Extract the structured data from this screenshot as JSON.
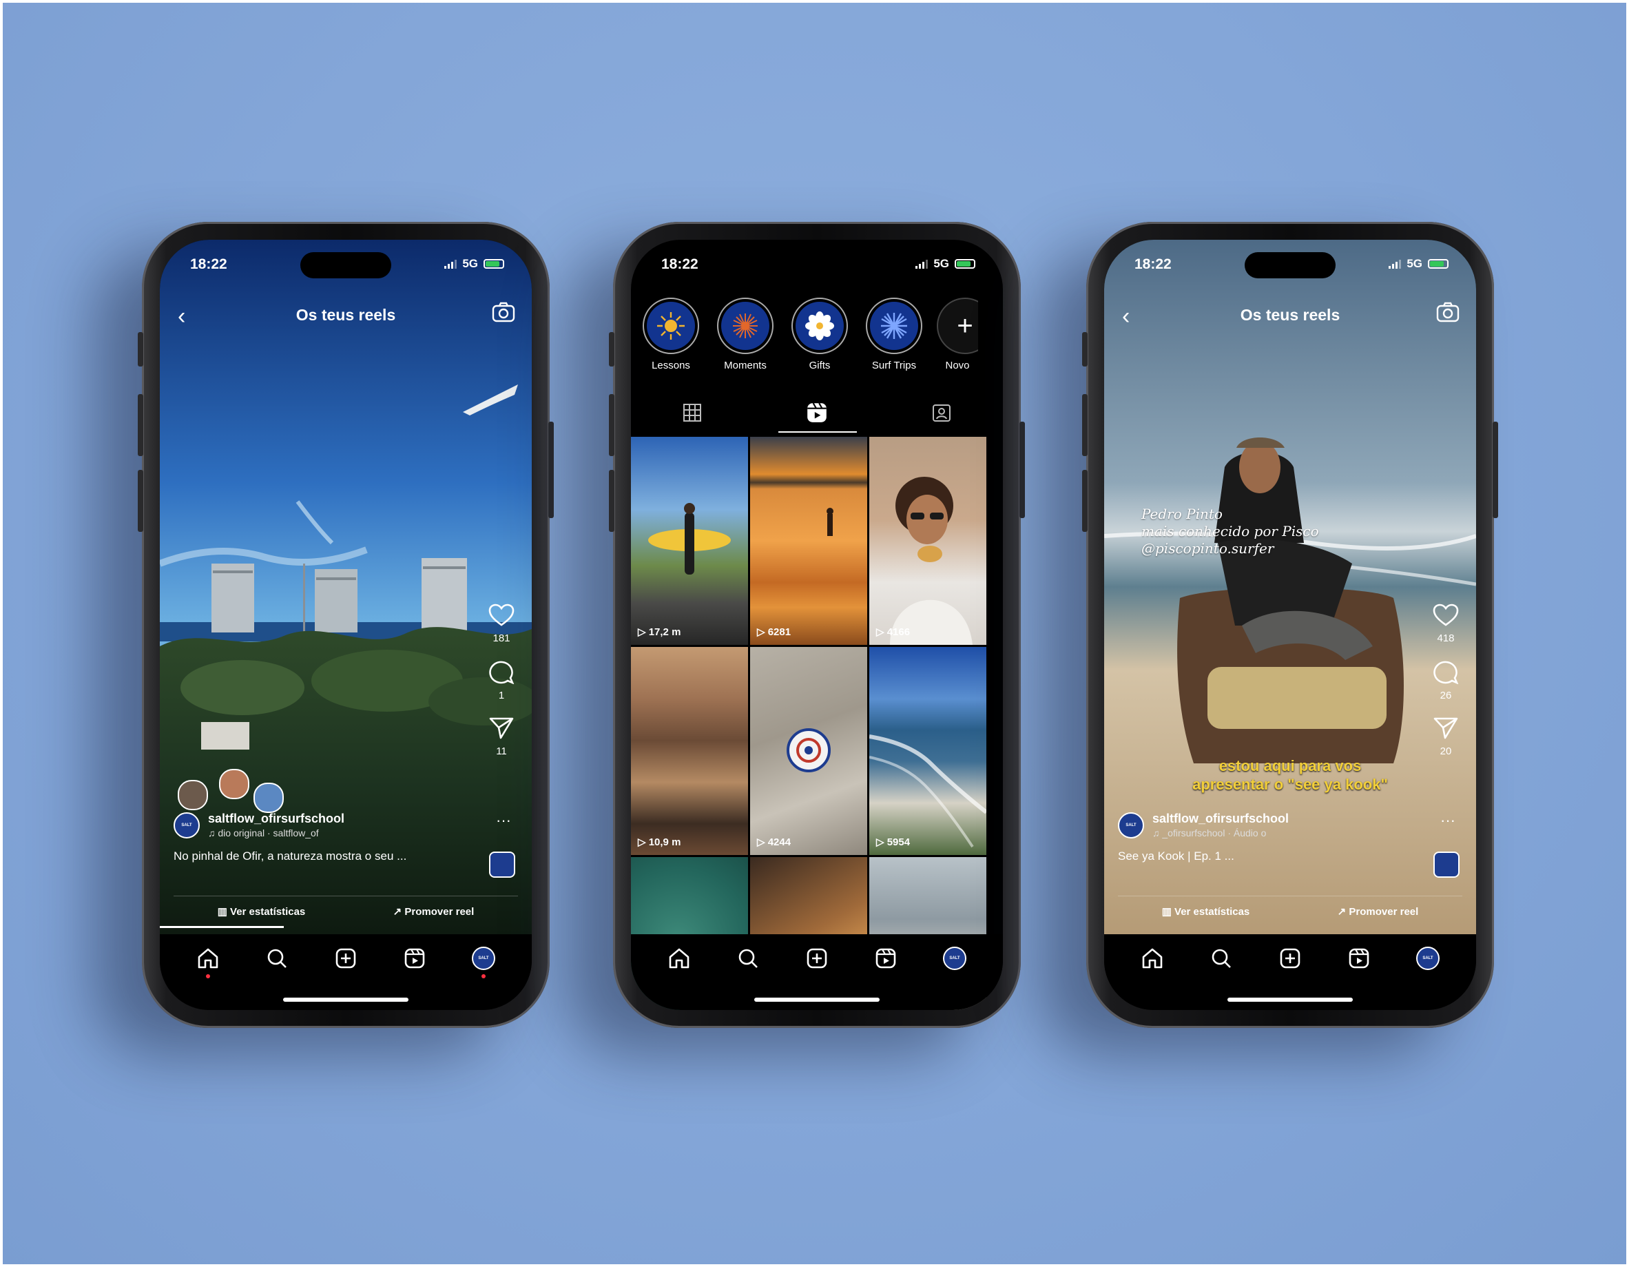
{
  "phones": [
    {
      "status": {
        "time": "18:22",
        "network": "5G"
      },
      "topbar": {
        "title": "Os teus reels"
      },
      "actions": {
        "likes": "181",
        "comments": "1",
        "shares": "11"
      },
      "caption": {
        "username": "saltflow_ofirsurfschool",
        "audio": "dio original · saltflow_of",
        "text": "No pinhal de Ofir, a natureza mostra o seu ..."
      },
      "links": {
        "stats": "Ver estatísticas",
        "promote": "Promover reel"
      },
      "avatar_badge": "SALT"
    },
    {
      "status": {
        "time": "18:22",
        "network": "5G"
      },
      "highlights": [
        "Lessons",
        "Moments",
        "Gifts",
        "Surf Trips",
        "Novo"
      ],
      "grid": [
        {
          "views": "17,2 m"
        },
        {
          "views": "6281"
        },
        {
          "views": "4166"
        },
        {
          "views": "10,9 m"
        },
        {
          "views": "4244"
        },
        {
          "views": "5954"
        },
        {
          "views": ""
        },
        {
          "views": ""
        },
        {
          "views": ""
        }
      ],
      "avatar_badge": "SALT"
    },
    {
      "status": {
        "time": "18:22",
        "network": "5G"
      },
      "topbar": {
        "title": "Os teus reels"
      },
      "overlay": {
        "hand_line_1": "Pedro Pinto",
        "hand_line_2": "mais conhecido por Pisco",
        "hand_line_3": "@piscopinto.surfer",
        "subtitle_line_1": "estou aqui para vos",
        "subtitle_line_2": "apresentar o \"see ya kook\""
      },
      "actions": {
        "likes": "418",
        "comments": "26",
        "shares": "20"
      },
      "caption": {
        "username": "saltflow_ofirsurfschool",
        "audio": "_ofirsurfschool · Áudio o",
        "text": "See ya Kook | Ep. 1 ..."
      },
      "links": {
        "stats": "Ver estatísticas",
        "promote": "Promover reel"
      },
      "avatar_badge": "SALT"
    }
  ],
  "colors": {
    "background": "#86a7d9",
    "accent_blue": "#12348f",
    "notification": "#ff3040",
    "subtitle_yellow": "#f2cf3a"
  }
}
